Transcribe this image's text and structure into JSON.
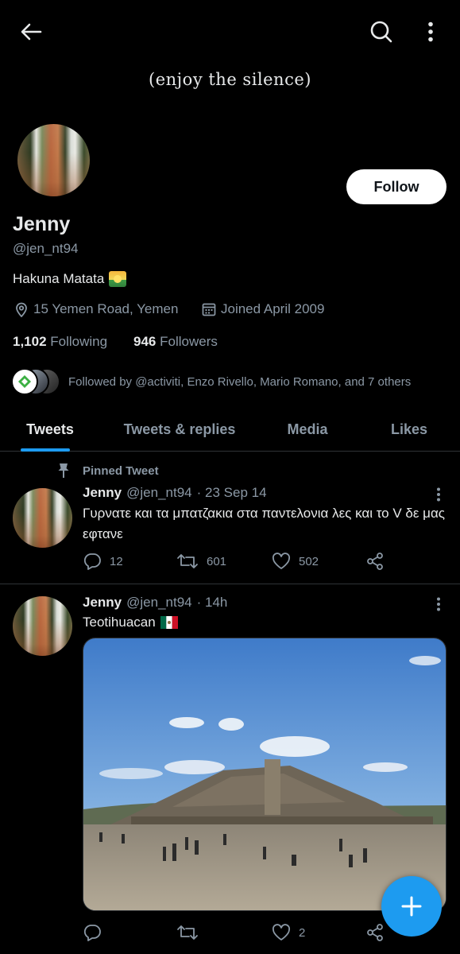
{
  "header": {
    "banner_text": "(enjoy the silence)",
    "back_icon": "arrow-left-icon",
    "search_icon": "search-icon",
    "more_icon": "more-vertical-icon"
  },
  "profile": {
    "name": "Jenny",
    "handle": "@jen_nt94",
    "bio": "Hakuna Matata",
    "bio_emoji": "sunrise-emoji",
    "location": "15 Yemen Road, Yemen",
    "joined": "Joined April 2009",
    "following_count": "1,102",
    "following_label": "Following",
    "followers_count": "946",
    "followers_label": "Followers",
    "followed_by": "Followed by @activiti, Enzo Rivello, Mario Romano, and 7 others",
    "follow_label": "Follow"
  },
  "tabs": [
    {
      "label": "Tweets",
      "active": true
    },
    {
      "label": "Tweets & replies",
      "active": false
    },
    {
      "label": "Media",
      "active": false
    },
    {
      "label": "Likes",
      "active": false
    }
  ],
  "tweets": [
    {
      "pinned_label": "Pinned Tweet",
      "name": "Jenny",
      "handle": "@jen_nt94",
      "time": "· 23 Sep 14",
      "text": "Γυρνατε και τα μπατζακια στα παντελονια λες και το V δε μας εφτανε",
      "replies": "12",
      "retweets": "601",
      "likes": "502"
    },
    {
      "name": "Jenny",
      "handle": "@jen_nt94",
      "time": "· 14h",
      "text": "Teotihuacan",
      "flag": "mexico-flag",
      "replies": "",
      "retweets": "",
      "likes": "2"
    }
  ],
  "colors": {
    "accent": "#1d9bf0",
    "background": "#000000",
    "muted": "#8b98a5",
    "text": "#e7e9ea"
  }
}
